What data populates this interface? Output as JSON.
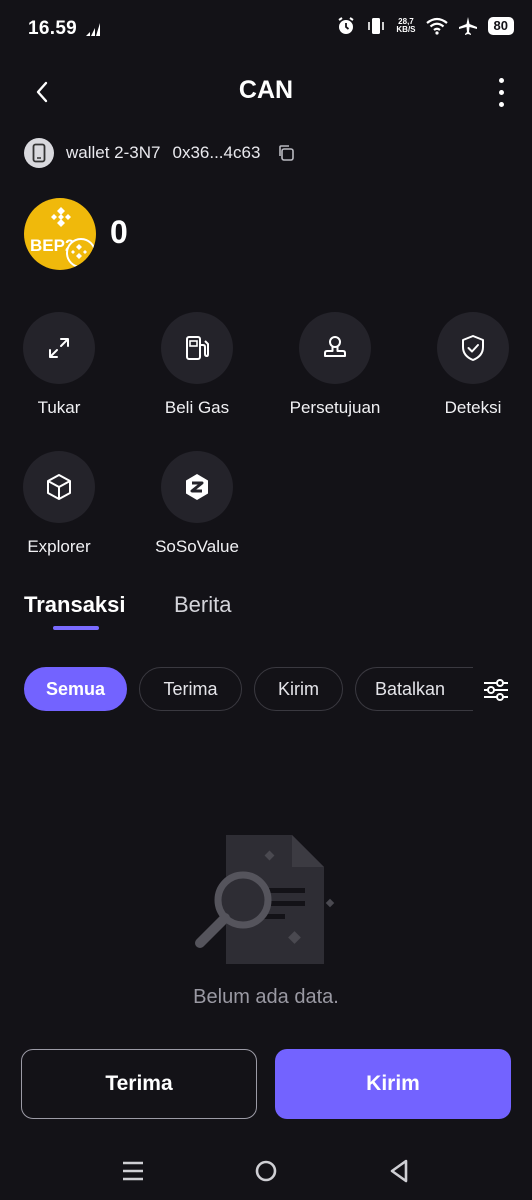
{
  "status_bar": {
    "time": "16.59",
    "network_speed_top": "28,7",
    "network_speed_bottom": "KB/S",
    "battery": "80"
  },
  "header": {
    "title": "CAN"
  },
  "wallet": {
    "name": "wallet 2-3N7",
    "address": "0x36...4c63"
  },
  "token": {
    "logo_text": "BEP20",
    "balance": "0",
    "logo_color": "#f0b90b"
  },
  "actions": [
    {
      "label": "Tukar",
      "icon": "swap-icon"
    },
    {
      "label": "Beli Gas",
      "icon": "gas-pump-icon"
    },
    {
      "label": "Persetujuan",
      "icon": "stamp-icon"
    },
    {
      "label": "Deteksi",
      "icon": "shield-check-icon"
    },
    {
      "label": "Explorer",
      "icon": "cube-icon"
    },
    {
      "label": "SoSoValue",
      "icon": "sosovalue-icon"
    }
  ],
  "tabs": [
    {
      "label": "Transaksi",
      "active": true
    },
    {
      "label": "Berita",
      "active": false
    }
  ],
  "filters": [
    {
      "label": "Semua",
      "active": true
    },
    {
      "label": "Terima",
      "active": false
    },
    {
      "label": "Kirim",
      "active": false
    },
    {
      "label": "Batalkan",
      "active": false
    }
  ],
  "empty_state": {
    "text": "Belum ada data."
  },
  "buttons": {
    "receive": "Terima",
    "send": "Kirim"
  },
  "colors": {
    "accent": "#7363ff",
    "background": "#131217",
    "surface": "#24232a"
  }
}
